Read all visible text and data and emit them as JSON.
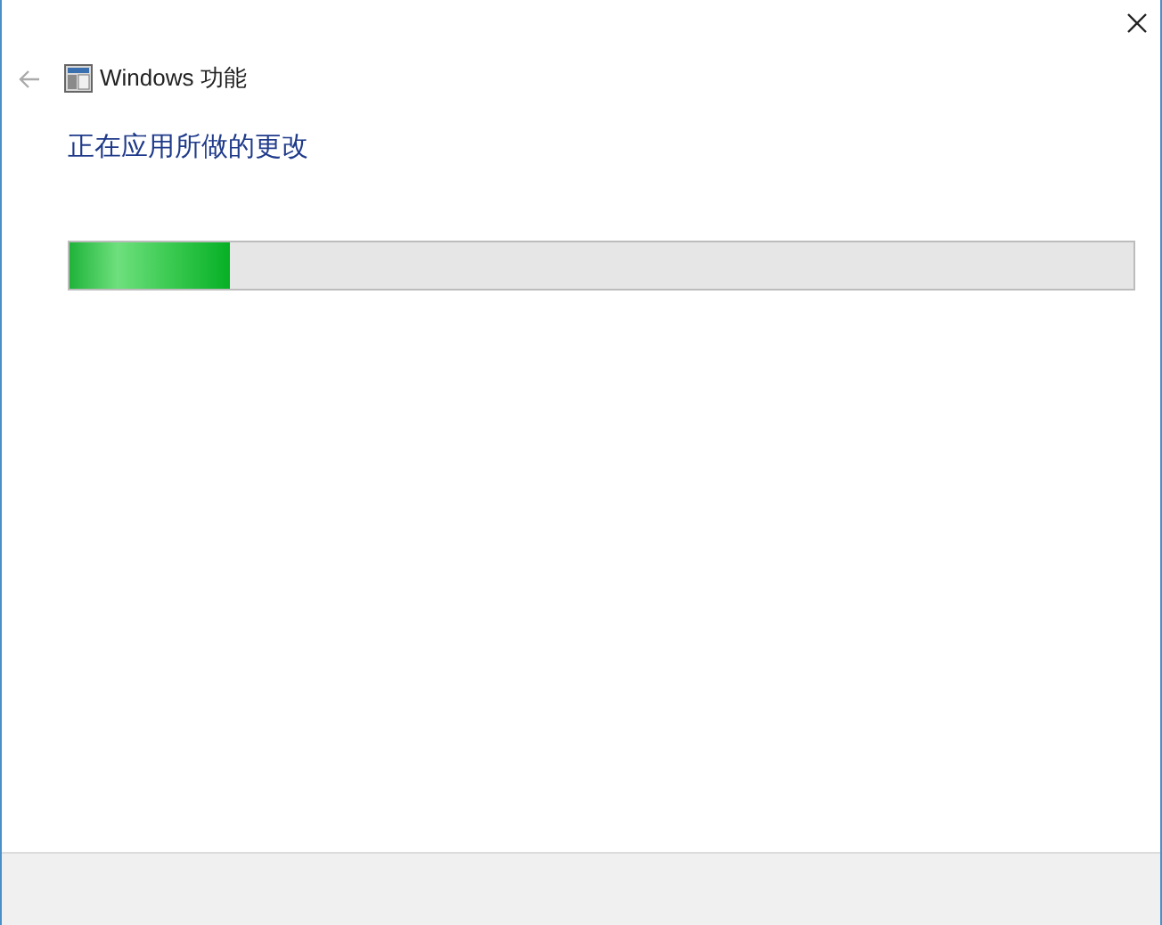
{
  "window": {
    "title": "Windows 功能"
  },
  "heading": "正在应用所做的更改",
  "progress": {
    "level": 0.15
  }
}
